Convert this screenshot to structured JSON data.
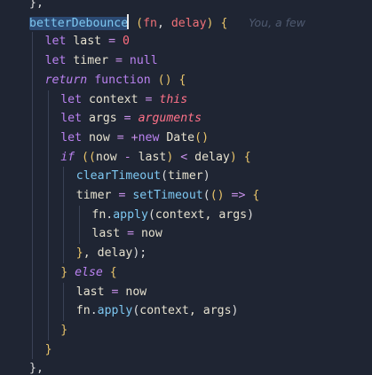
{
  "editor": {
    "colors": {
      "background": "#1f2533",
      "default": "#e6e1cf",
      "keyword": "#ba82f0",
      "function": "#7ec8f2",
      "operator": "#c891ea",
      "number": "#ff6e7f",
      "special": "#ff7289",
      "punct": "#dcdcdc",
      "bracket": "#e9c46a",
      "param": "#f07178"
    },
    "cursor_after_token": "betterDebounce",
    "lines": [
      {
        "indent": 0,
        "top_partial": true,
        "tokens": [
          {
            "t": "},",
            "c": "punct"
          }
        ]
      },
      {
        "indent": 0,
        "tokens": [
          {
            "t": "betterDebounce",
            "c": "function",
            "selected": true
          },
          {
            "t": " ",
            "c": "default"
          },
          {
            "t": "(",
            "c": "bracket"
          },
          {
            "t": "fn",
            "c": "param"
          },
          {
            "t": ", ",
            "c": "punct"
          },
          {
            "t": "delay",
            "c": "param"
          },
          {
            "t": ")",
            "c": "bracket"
          },
          {
            "t": " {",
            "c": "bracket"
          },
          {
            "t": "      You, a few",
            "c": "blame"
          }
        ]
      },
      {
        "indent": 1,
        "tokens": [
          {
            "t": "let",
            "c": "keyword"
          },
          {
            "t": " last ",
            "c": "default"
          },
          {
            "t": "=",
            "c": "operator"
          },
          {
            "t": " ",
            "c": "default"
          },
          {
            "t": "0",
            "c": "number"
          }
        ]
      },
      {
        "indent": 1,
        "tokens": [
          {
            "t": "let",
            "c": "keyword"
          },
          {
            "t": " timer ",
            "c": "default"
          },
          {
            "t": "=",
            "c": "operator"
          },
          {
            "t": " ",
            "c": "default"
          },
          {
            "t": "null",
            "c": "keyword"
          }
        ]
      },
      {
        "indent": 1,
        "tokens": [
          {
            "t": "return",
            "c": "keyword_italic"
          },
          {
            "t": " ",
            "c": "default"
          },
          {
            "t": "function",
            "c": "keyword"
          },
          {
            "t": " ",
            "c": "default"
          },
          {
            "t": "()",
            "c": "bracket"
          },
          {
            "t": " {",
            "c": "bracket"
          }
        ]
      },
      {
        "indent": 2,
        "tokens": [
          {
            "t": "let",
            "c": "keyword"
          },
          {
            "t": " context ",
            "c": "default"
          },
          {
            "t": "=",
            "c": "operator"
          },
          {
            "t": " ",
            "c": "default"
          },
          {
            "t": "this",
            "c": "special_italic"
          }
        ]
      },
      {
        "indent": 2,
        "tokens": [
          {
            "t": "let",
            "c": "keyword"
          },
          {
            "t": " args ",
            "c": "default"
          },
          {
            "t": "=",
            "c": "operator"
          },
          {
            "t": " ",
            "c": "default"
          },
          {
            "t": "arguments",
            "c": "special_italic"
          }
        ]
      },
      {
        "indent": 2,
        "tokens": [
          {
            "t": "let",
            "c": "keyword"
          },
          {
            "t": " now ",
            "c": "default"
          },
          {
            "t": "=",
            "c": "operator"
          },
          {
            "t": " ",
            "c": "default"
          },
          {
            "t": "+",
            "c": "operator"
          },
          {
            "t": "new",
            "c": "keyword"
          },
          {
            "t": " ",
            "c": "default"
          },
          {
            "t": "Date",
            "c": "default"
          },
          {
            "t": "()",
            "c": "bracket"
          }
        ]
      },
      {
        "indent": 2,
        "tokens": [
          {
            "t": "if",
            "c": "keyword_italic"
          },
          {
            "t": " ",
            "c": "default"
          },
          {
            "t": "((",
            "c": "bracket"
          },
          {
            "t": "now ",
            "c": "default"
          },
          {
            "t": "-",
            "c": "operator"
          },
          {
            "t": " last",
            "c": "default"
          },
          {
            "t": ")",
            "c": "bracket"
          },
          {
            "t": " ",
            "c": "default"
          },
          {
            "t": "<",
            "c": "operator"
          },
          {
            "t": " delay",
            "c": "default"
          },
          {
            "t": ")",
            "c": "bracket"
          },
          {
            "t": " {",
            "c": "bracket"
          }
        ]
      },
      {
        "indent": 3,
        "tokens": [
          {
            "t": "clearTimeout",
            "c": "function"
          },
          {
            "t": "(",
            "c": "punct"
          },
          {
            "t": "timer",
            "c": "default"
          },
          {
            "t": ")",
            "c": "punct"
          }
        ]
      },
      {
        "indent": 3,
        "tokens": [
          {
            "t": "timer ",
            "c": "default"
          },
          {
            "t": "=",
            "c": "operator"
          },
          {
            "t": " ",
            "c": "default"
          },
          {
            "t": "setTimeout",
            "c": "function"
          },
          {
            "t": "(",
            "c": "punct"
          },
          {
            "t": "()",
            "c": "bracket"
          },
          {
            "t": " ",
            "c": "default"
          },
          {
            "t": "=>",
            "c": "operator"
          },
          {
            "t": " {",
            "c": "bracket"
          }
        ]
      },
      {
        "indent": 4,
        "tokens": [
          {
            "t": "fn",
            "c": "default"
          },
          {
            "t": ".",
            "c": "punct"
          },
          {
            "t": "apply",
            "c": "function"
          },
          {
            "t": "(",
            "c": "punct"
          },
          {
            "t": "context, args",
            "c": "default"
          },
          {
            "t": ")",
            "c": "punct"
          }
        ]
      },
      {
        "indent": 4,
        "tokens": [
          {
            "t": "last ",
            "c": "default"
          },
          {
            "t": "=",
            "c": "operator"
          },
          {
            "t": " now",
            "c": "default"
          }
        ]
      },
      {
        "indent": 3,
        "tokens": [
          {
            "t": "}",
            "c": "bracket"
          },
          {
            "t": ", delay",
            "c": "default"
          },
          {
            "t": ");",
            "c": "punct"
          }
        ]
      },
      {
        "indent": 2,
        "tokens": [
          {
            "t": "}",
            "c": "bracket"
          },
          {
            "t": " ",
            "c": "default"
          },
          {
            "t": "else",
            "c": "keyword_italic"
          },
          {
            "t": " {",
            "c": "bracket"
          }
        ]
      },
      {
        "indent": 3,
        "tokens": [
          {
            "t": "last ",
            "c": "default"
          },
          {
            "t": "=",
            "c": "operator"
          },
          {
            "t": " now",
            "c": "default"
          }
        ]
      },
      {
        "indent": 3,
        "tokens": [
          {
            "t": "fn",
            "c": "default"
          },
          {
            "t": ".",
            "c": "punct"
          },
          {
            "t": "apply",
            "c": "function"
          },
          {
            "t": "(",
            "c": "punct"
          },
          {
            "t": "context, args",
            "c": "default"
          },
          {
            "t": ")",
            "c": "punct"
          }
        ]
      },
      {
        "indent": 2,
        "tokens": [
          {
            "t": "}",
            "c": "bracket"
          }
        ]
      },
      {
        "indent": 1,
        "tokens": [
          {
            "t": "}",
            "c": "bracket"
          }
        ]
      },
      {
        "indent": 0,
        "tokens": [
          {
            "t": "},",
            "c": "punct"
          }
        ]
      }
    ]
  }
}
